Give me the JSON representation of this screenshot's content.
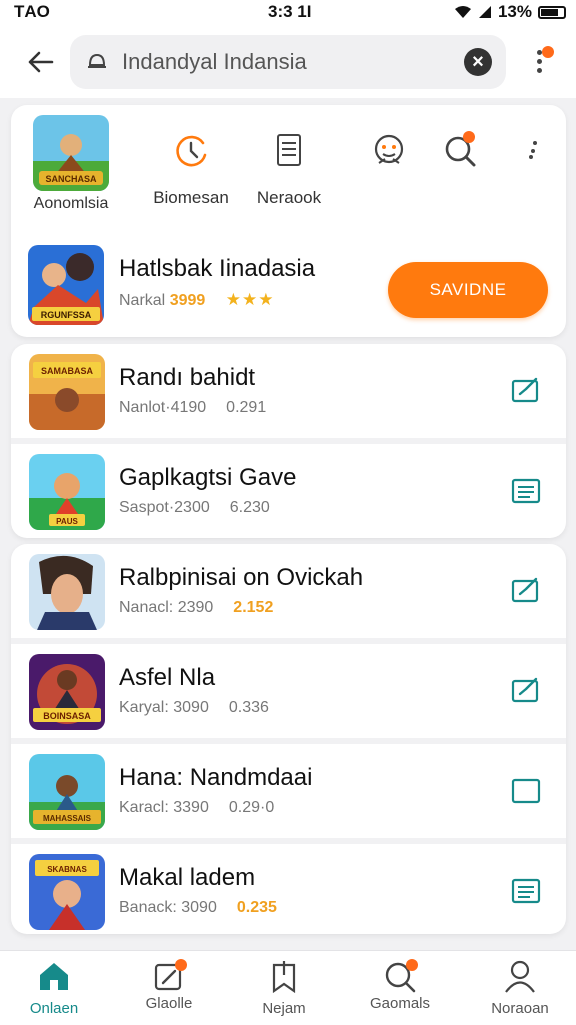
{
  "status_bar": {
    "carrier": "ΤAO",
    "time": "3:3 1Ι",
    "battery": "13%"
  },
  "search": {
    "query": "Indandyal Indansia"
  },
  "shortcuts": [
    {
      "label": "Aonomlsia"
    },
    {
      "label": "Biomesan"
    },
    {
      "label": "Neraook"
    }
  ],
  "featured": {
    "title": "Hatlsbak Iinadasia",
    "sub_label": "Narkal",
    "sub_value": "3999",
    "stars": "★★★",
    "button_label": "SAVIDNE",
    "thumb_text": "RGUNFSSA"
  },
  "games": [
    {
      "title": "Randı bahidt",
      "sub_label": "Nanlot·4190",
      "metric": "0.291",
      "highlight": false,
      "action_icon": "edit-check-icon",
      "thumb_text": "SAMABASA"
    },
    {
      "title": "Gaplkagtsi Gave",
      "sub_label": "Saspot·2300",
      "metric": "6.230",
      "highlight": false,
      "action_icon": "list-icon",
      "thumb_text": "PAUS"
    },
    {
      "title": "Ralbpinisai on Ovickah",
      "sub_label": "Nanacl: 2390",
      "metric": "2.152",
      "highlight": true,
      "action_icon": "edit-check-icon",
      "thumb_text": ""
    },
    {
      "title": "Asfel Nla",
      "sub_label": "Karyal: 3090",
      "metric": "0.336",
      "highlight": false,
      "action_icon": "edit-check-icon",
      "thumb_text": "BOINSASA"
    },
    {
      "title": "Hana: Nandmdaai",
      "sub_label": "Karacl: 3390",
      "metric": "0.29·0",
      "highlight": false,
      "action_icon": "empty-box-icon",
      "thumb_text": "MAHASSAIS"
    },
    {
      "title": "Makal ladem",
      "sub_label": "Banack: 3090",
      "metric": "0.235",
      "highlight": true,
      "action_icon": "list-icon",
      "thumb_text": "SKABNAS"
    }
  ],
  "bottom_nav": [
    {
      "label": "Onlaen",
      "icon": "home-icon",
      "active": true
    },
    {
      "label": "Glaolle",
      "icon": "edit-icon",
      "active": false
    },
    {
      "label": "Nejam",
      "icon": "bookmark-icon",
      "active": false
    },
    {
      "label": "Gaomals",
      "icon": "search-icon",
      "active": false
    },
    {
      "label": "Noraoan",
      "icon": "person-icon",
      "active": false
    }
  ],
  "colors": {
    "accent": "#ff7a0e",
    "teal": "#168a8a",
    "star": "#f3b21d"
  }
}
